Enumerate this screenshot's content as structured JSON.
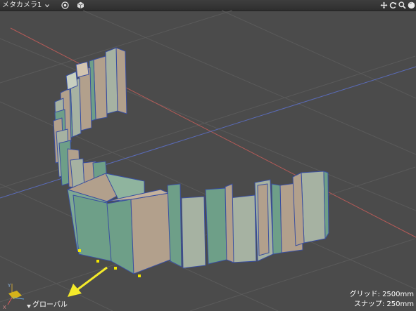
{
  "titlebar": {
    "camera_name": "メタカメラ1",
    "icons": [
      "camera-menu-chevron-icon",
      "target-icon",
      "cube-icon",
      "move-icon",
      "rotate-icon",
      "zoom-icon",
      "sphere-icon"
    ]
  },
  "status": {
    "grid_label": "グリッド: 2500mm",
    "snap_label": "スナップ: 250mm"
  },
  "axis_gizmo": {
    "coordinate_space_label": "グローバル",
    "axis_labels": {
      "x": "X",
      "y": "Y"
    }
  },
  "colors": {
    "background": "#4b4b4b",
    "grid_line": "#5a5a5a",
    "x_axis_line": "#b35a57",
    "z_axis_line": "#5a6bb8",
    "panel_face_light": "#a6b2a2",
    "panel_face_dark": "#6e9f88",
    "panel_face_tan": "#b2a08c",
    "panel_edge": "#3a4fa0",
    "vertex_selected": "#f2e600",
    "arrow": "#f4ea2a"
  }
}
